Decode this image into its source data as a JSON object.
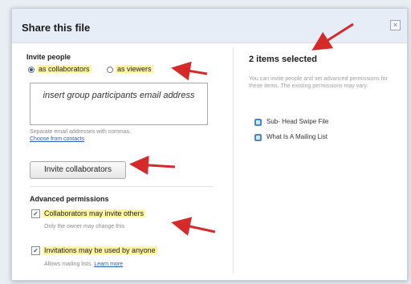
{
  "dialog": {
    "title": "Share this file",
    "close_glyph": "×"
  },
  "invite": {
    "section_label": "Invite people",
    "as_collaborators": "as collaborators",
    "as_viewers": "as viewers",
    "email_value": "insert group participants email address",
    "hint": "Separate email addresses with commas.",
    "choose_contacts": "Choose from contacts",
    "invite_button": "Invite collaborators"
  },
  "advanced": {
    "heading": "Advanced permissions",
    "collab_invite": "Collaborators may invite others",
    "collab_note": "Only the owner may change this",
    "invitations_anyone": "Invitations may be used by anyone",
    "invitations_note": "Allows mailing lists.",
    "learn_more": "Learn more"
  },
  "right": {
    "heading": "2 items selected",
    "description": "You can invite people and set advanced permissions for these items. The existing permissions may vary.",
    "items": [
      "Sub- Head Swipe File",
      "What Is A Mailing List"
    ]
  },
  "colors": {
    "highlight": "#fff59a",
    "arrow": "#d42a2a",
    "link": "#2a5db0"
  }
}
